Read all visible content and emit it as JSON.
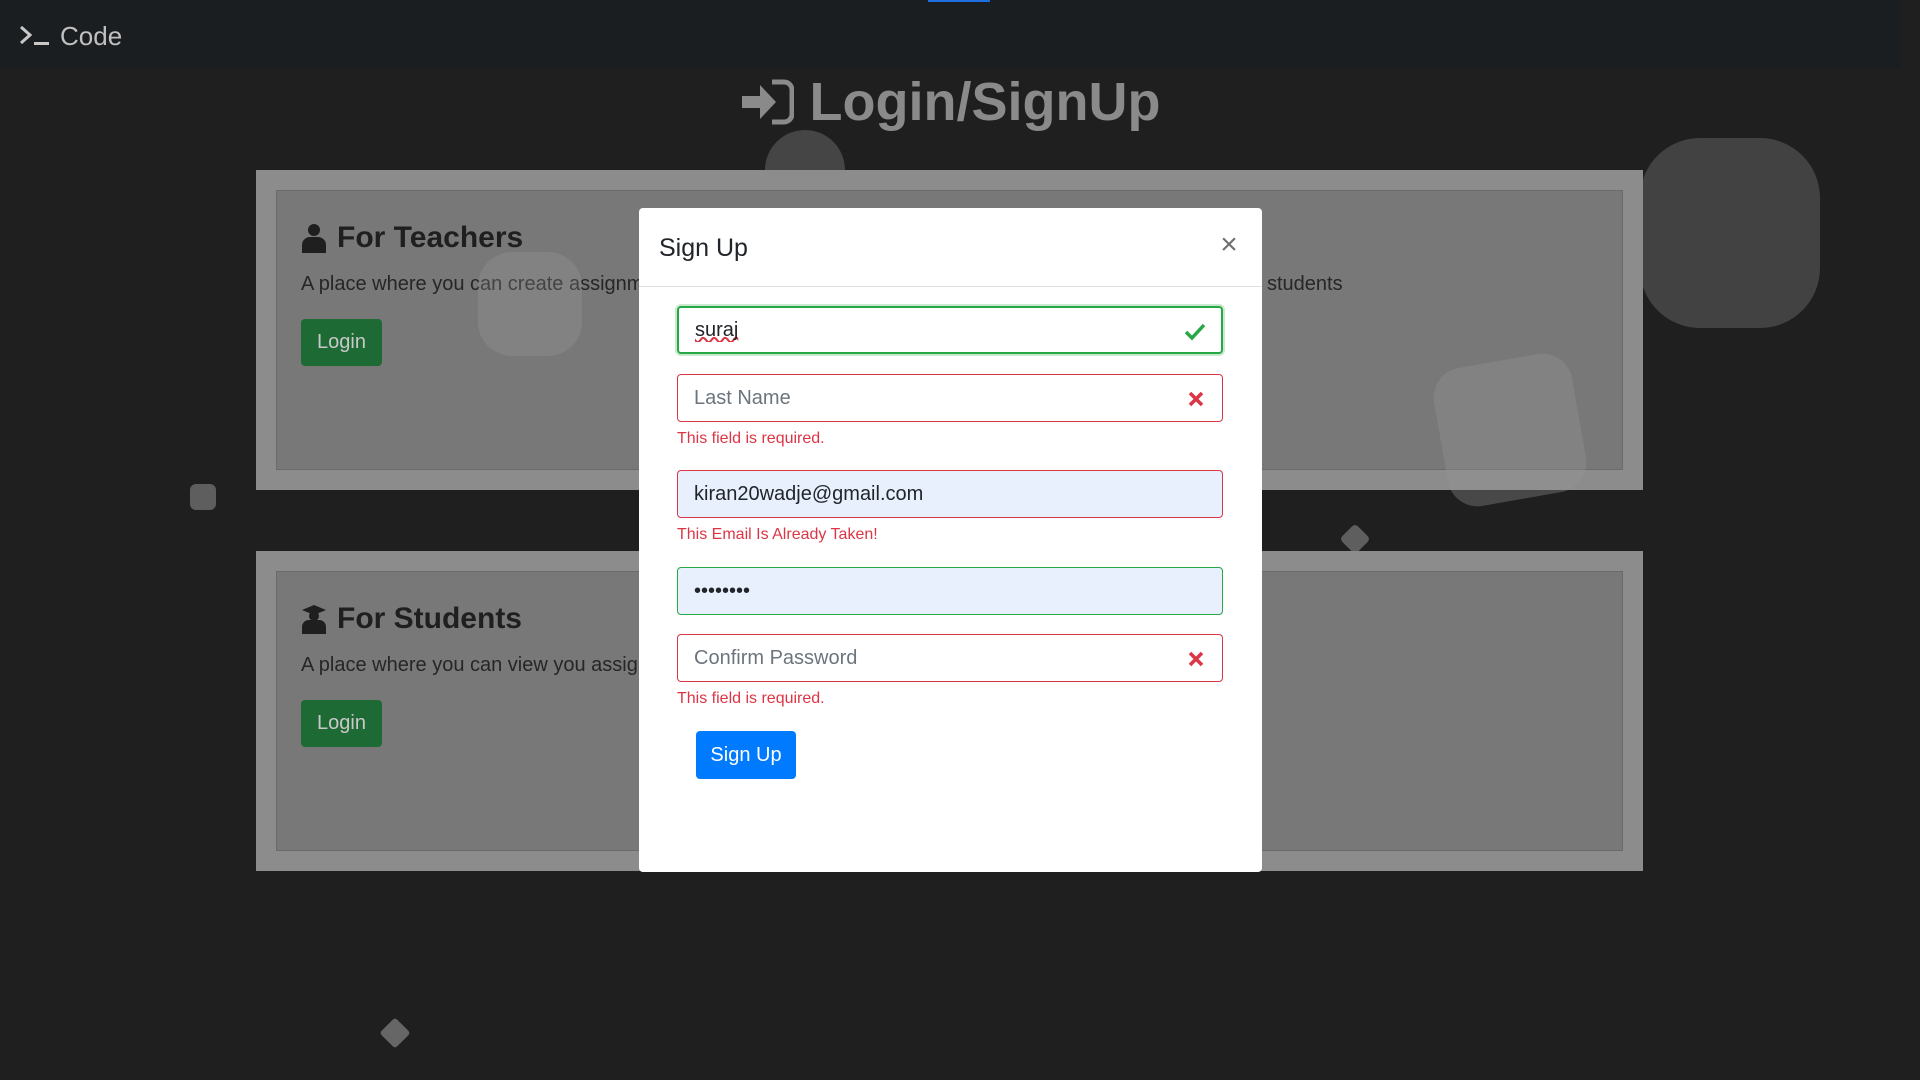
{
  "app": {
    "brand": "Code"
  },
  "page": {
    "title": "Login/SignUp"
  },
  "teachers": {
    "title": "For Teachers",
    "text": "A place where you can create assignm",
    "text_right": "students",
    "login": "Login"
  },
  "students": {
    "title": "For Students",
    "text": "A place where you can view you assig",
    "login": "Login"
  },
  "modal": {
    "title": "Sign Up",
    "close": "×",
    "first_name": {
      "value": "suraj",
      "state": "valid"
    },
    "last_name": {
      "value": "",
      "placeholder": "Last Name",
      "state": "invalid",
      "error": "This field is required."
    },
    "email": {
      "value": "kiran20wadje@gmail.com",
      "state": "invalid",
      "error": "This Email Is Already Taken!"
    },
    "password": {
      "value": "suraj123",
      "state": "valid"
    },
    "confirm_password": {
      "value": "",
      "placeholder": "Confirm Password",
      "state": "invalid",
      "error": "This field is required."
    },
    "submit": "Sign Up"
  },
  "colors": {
    "success": "#28a745",
    "danger": "#dc3545",
    "primary": "#007bff",
    "login_green": "#1e6a34"
  }
}
